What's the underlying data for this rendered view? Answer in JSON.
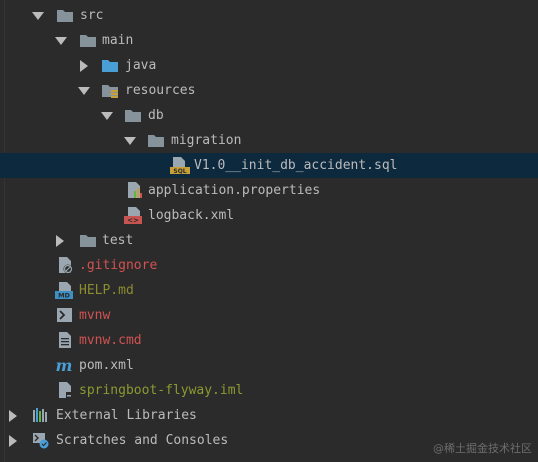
{
  "tree": {
    "src": "src",
    "main": "main",
    "java": "java",
    "resources": "resources",
    "db": "db",
    "migration": "migration",
    "sql_file": "V1.0__init_db_accident.sql",
    "app_props": "application.properties",
    "logback": "logback.xml",
    "test": "test",
    "gitignore": ".gitignore",
    "help_md": "HELP.md",
    "mvnw": "mvnw",
    "mvnw_cmd": "mvnw.cmd",
    "pom": "pom.xml",
    "iml": "springboot-flyway.iml",
    "ext_libs": "External Libraries",
    "scratches": "Scratches and Consoles"
  },
  "watermark": "@稀土掘金技术社区",
  "colors": {
    "background": "#2b2b2b",
    "selected_row": "#0d293e",
    "folder": "#87939a",
    "source_folder": "#4a9ed6",
    "ignored_red": "#d25252",
    "new_olive": "#8b8c2f",
    "modified_amber": "#c9a038",
    "text": "#bbbbbb"
  }
}
